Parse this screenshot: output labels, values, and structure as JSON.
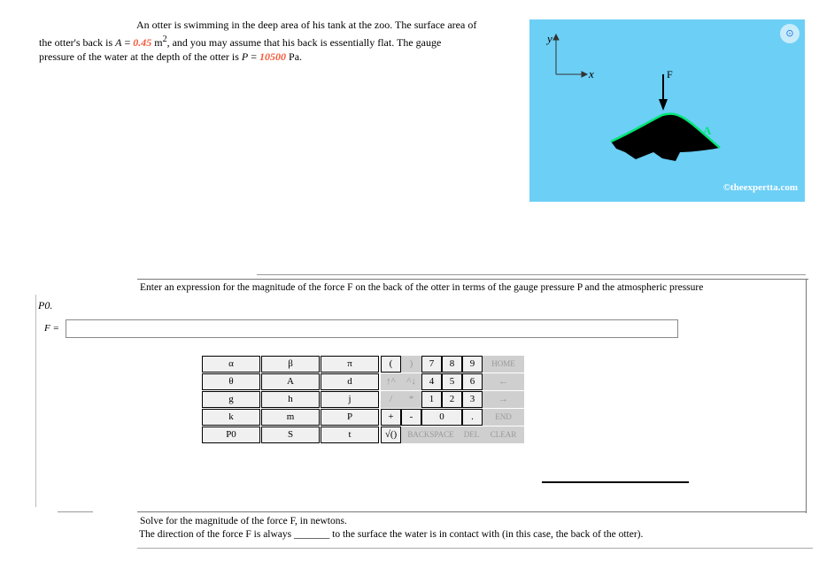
{
  "problem": {
    "l1": "An otter is swimming in the deep area of his tank at the zoo. The surface area of",
    "l2a": "the otter's back is ",
    "A_sym": "A",
    "eq": " = ",
    "A_val": "0.45",
    "A_unit": " m",
    "sup": "2",
    "l2b": ", and you may assume that his back is essentially flat. The gauge",
    "l3a": "pressure of the water at the depth of the otter is ",
    "P_sym": "P",
    "P_val": "10500",
    "P_unit": " Pa."
  },
  "figure": {
    "y_label": "y",
    "x_label": "x",
    "force_label": "F",
    "area_label": "A",
    "copyright": "©theexpertta.com",
    "lens_icon": "lens-icon",
    "bg": "#6ccff6",
    "outline": "#00e676"
  },
  "part1": {
    "prompt": "Enter an expression for the magnitude of the force F on the back of the otter in terms of the gauge pressure P and the atmospheric pressure",
    "prompt_end": "P0.",
    "input_label": "F = ",
    "input_value": ""
  },
  "keypad": {
    "vars": [
      "α",
      "β",
      "π",
      "θ",
      "A",
      "d",
      "g",
      "h",
      "j",
      "k",
      "m",
      "P",
      "P0",
      "S",
      "t"
    ],
    "keys": [
      [
        "(",
        ")",
        "7",
        "8",
        "9",
        "HOME"
      ],
      [
        "↑^",
        "^↓",
        "4",
        "5",
        "6",
        "←"
      ],
      [
        "/",
        "*",
        "1",
        "2",
        "3",
        "→"
      ],
      [
        "+",
        "-",
        "0",
        ".",
        "END"
      ],
      [
        "√()",
        "BACKSPACE",
        "DEL",
        "CLEAR"
      ]
    ]
  },
  "part2": {
    "l1": "Solve for the magnitude of the force F, in newtons.",
    "l2": "The direction of the force F is always _______ to the surface the water is in contact with (in this case, the back of the otter)."
  }
}
